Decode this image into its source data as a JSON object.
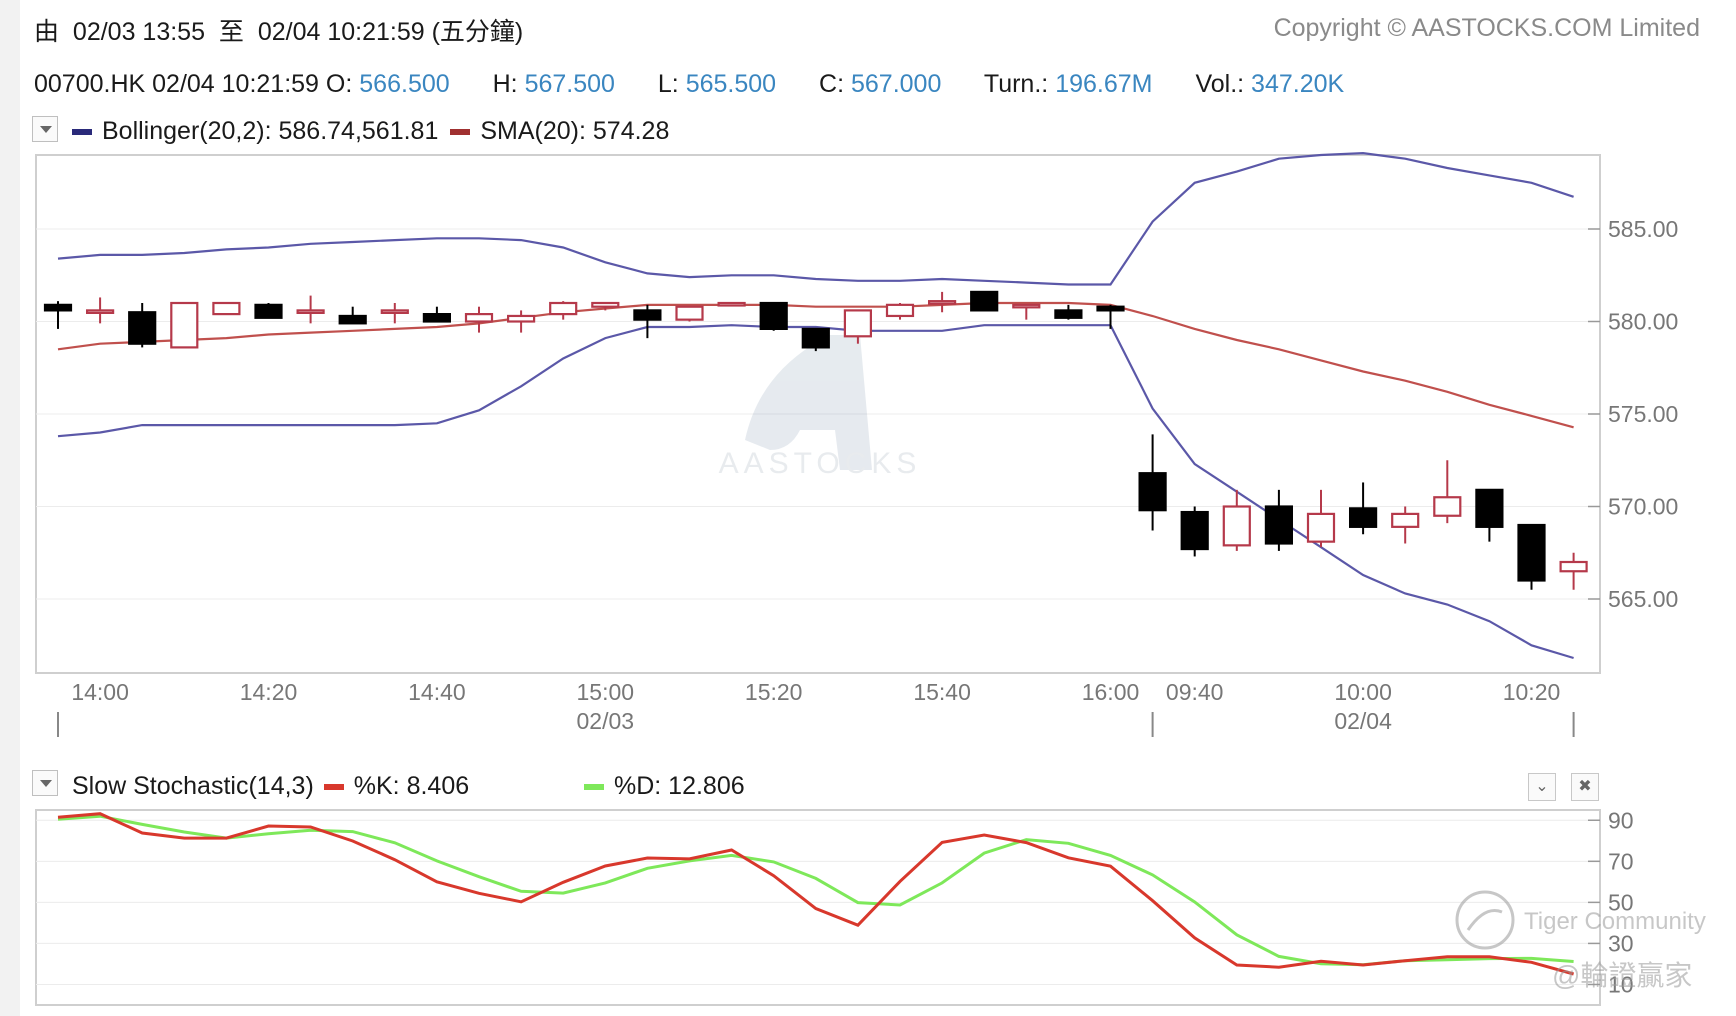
{
  "header": {
    "range_prefix": "由",
    "range_from": "02/03 13:55",
    "range_sep": "至",
    "range_to": "02/04 10:21:59 (五分鐘)",
    "copyright": "Copyright © AASTOCKS.COM Limited"
  },
  "quote": {
    "symbol_time": "00700.HK 02/04 10:21:59",
    "open_label": "O:",
    "open": "566.500",
    "high_label": "H:",
    "high": "567.500",
    "low_label": "L:",
    "low": "565.500",
    "close_label": "C:",
    "close": "567.000",
    "turn_label": "Turn.:",
    "turn": "196.67M",
    "vol_label": "Vol.:",
    "vol": "347.20K"
  },
  "main_legend": {
    "boll_label": "Bollinger(20,2): 586.74,561.81",
    "sma_label": "SMA(20): 574.28"
  },
  "stoch_legend": {
    "title": "Slow Stochastic(14,3)",
    "k_label": "%K: 8.406",
    "d_label": "%D: 12.806"
  },
  "watermarks": {
    "aastocks": "AASTOCKS",
    "tiger": "Tiger Community",
    "handle": "@輪證贏家"
  },
  "colors": {
    "boll": "#5b58a8",
    "sma": "#c0504d",
    "up": "#b5394a",
    "down": "#000000",
    "k": "#d8382c",
    "d": "#7ee85a",
    "value_blue": "#3a86c0"
  },
  "chart_data": [
    {
      "type": "candlestick",
      "title": "00700.HK",
      "x_time_labels": [
        "14:00",
        "14:20",
        "14:40",
        "15:00",
        "15:20",
        "15:40",
        "16:00",
        "09:40",
        "10:00",
        "10:20"
      ],
      "x_date_labels": [
        "02/03",
        "02/04"
      ],
      "y_ticks": [
        "585.00",
        "580.00",
        "575.00",
        "570.00",
        "565.00"
      ],
      "ylim": [
        561,
        589
      ],
      "grid": true,
      "candles": [
        {
          "o": 580.9,
          "h": 581.1,
          "l": 579.6,
          "c": 580.6
        },
        {
          "o": 580.6,
          "h": 581.3,
          "l": 579.9,
          "c": 580.6
        },
        {
          "o": 580.5,
          "h": 581.0,
          "l": 578.6,
          "c": 578.8
        },
        {
          "o": 578.6,
          "h": 581.0,
          "l": 578.6,
          "c": 581.0
        },
        {
          "o": 580.4,
          "h": 581.0,
          "l": 580.4,
          "c": 581.0
        },
        {
          "o": 580.9,
          "h": 581.0,
          "l": 580.2,
          "c": 580.2
        },
        {
          "o": 580.6,
          "h": 581.4,
          "l": 579.9,
          "c": 580.6
        },
        {
          "o": 580.3,
          "h": 580.8,
          "l": 579.9,
          "c": 579.9
        },
        {
          "o": 580.6,
          "h": 581.0,
          "l": 579.9,
          "c": 580.6
        },
        {
          "o": 580.4,
          "h": 580.8,
          "l": 580.0,
          "c": 580.0
        },
        {
          "o": 580.0,
          "h": 580.8,
          "l": 579.4,
          "c": 580.4
        },
        {
          "o": 580.0,
          "h": 580.6,
          "l": 579.4,
          "c": 580.3
        },
        {
          "o": 580.4,
          "h": 581.1,
          "l": 580.1,
          "c": 581.0
        },
        {
          "o": 580.8,
          "h": 581.0,
          "l": 580.6,
          "c": 581.0
        },
        {
          "o": 580.6,
          "h": 580.9,
          "l": 579.1,
          "c": 580.1
        },
        {
          "o": 580.1,
          "h": 580.8,
          "l": 580.0,
          "c": 580.8
        },
        {
          "o": 580.9,
          "h": 581.0,
          "l": 580.9,
          "c": 581.0
        },
        {
          "o": 581.0,
          "h": 581.0,
          "l": 579.5,
          "c": 579.6
        },
        {
          "o": 579.6,
          "h": 579.6,
          "l": 578.4,
          "c": 578.6
        },
        {
          "o": 579.2,
          "h": 580.6,
          "l": 578.8,
          "c": 580.6
        },
        {
          "o": 580.3,
          "h": 581.0,
          "l": 580.1,
          "c": 580.9
        },
        {
          "o": 581.1,
          "h": 581.6,
          "l": 580.5,
          "c": 581.1
        },
        {
          "o": 581.6,
          "h": 581.6,
          "l": 580.6,
          "c": 580.6
        },
        {
          "o": 580.9,
          "h": 580.9,
          "l": 580.1,
          "c": 580.9
        },
        {
          "o": 580.6,
          "h": 580.9,
          "l": 580.1,
          "c": 580.2
        },
        {
          "o": 580.8,
          "h": 580.9,
          "l": 579.6,
          "c": 580.6
        },
        {
          "o": 571.8,
          "h": 573.9,
          "l": 568.7,
          "c": 569.8
        },
        {
          "o": 569.7,
          "h": 570.0,
          "l": 567.3,
          "c": 567.7
        },
        {
          "o": 567.9,
          "h": 570.9,
          "l": 567.6,
          "c": 570.0
        },
        {
          "o": 570.0,
          "h": 570.9,
          "l": 567.6,
          "c": 568.0
        },
        {
          "o": 568.1,
          "h": 570.9,
          "l": 567.8,
          "c": 569.6
        },
        {
          "o": 569.9,
          "h": 571.3,
          "l": 568.5,
          "c": 568.9
        },
        {
          "o": 568.9,
          "h": 570.0,
          "l": 568.0,
          "c": 569.6
        },
        {
          "o": 569.5,
          "h": 572.5,
          "l": 569.1,
          "c": 570.5
        },
        {
          "o": 570.9,
          "h": 570.9,
          "l": 568.1,
          "c": 568.9
        },
        {
          "o": 569.0,
          "h": 569.0,
          "l": 565.5,
          "c": 566.0
        },
        {
          "o": 566.5,
          "h": 567.5,
          "l": 565.5,
          "c": 567.0
        }
      ],
      "series": [
        {
          "name": "Bollinger(20,2)",
          "type": "line",
          "values": [
            583.4,
            583.6,
            583.6,
            583.7,
            583.9,
            584.0,
            584.2,
            584.3,
            584.4,
            584.5,
            584.5,
            584.4,
            584.0,
            583.2,
            582.6,
            582.4,
            582.5,
            582.5,
            582.3,
            582.2,
            582.2,
            582.3,
            582.2,
            582.1,
            582.0,
            582.0,
            585.4,
            587.5,
            588.1,
            588.8,
            589.0,
            589.1,
            588.8,
            588.3,
            587.9,
            587.5,
            586.74
          ]
        },
        {
          "name": "Bollinger(20,2)",
          "type": "line",
          "values": [
            573.8,
            574.0,
            574.4,
            574.4,
            574.4,
            574.4,
            574.4,
            574.4,
            574.4,
            574.5,
            575.2,
            576.5,
            578.0,
            579.1,
            579.7,
            579.7,
            579.8,
            579.7,
            579.7,
            579.5,
            579.5,
            579.5,
            579.8,
            579.8,
            579.8,
            579.8,
            575.3,
            572.3,
            570.8,
            569.3,
            567.8,
            566.3,
            565.3,
            564.7,
            563.8,
            562.5,
            561.81
          ]
        },
        {
          "name": "SMA(20)",
          "type": "line",
          "values": [
            578.5,
            578.8,
            578.9,
            579.0,
            579.1,
            579.3,
            579.4,
            579.5,
            579.6,
            579.7,
            579.9,
            580.2,
            580.5,
            580.7,
            580.9,
            580.9,
            580.9,
            580.9,
            580.8,
            580.8,
            580.8,
            580.9,
            581.0,
            581.0,
            581.0,
            580.9,
            580.3,
            579.6,
            579.0,
            578.5,
            577.9,
            577.3,
            576.8,
            576.2,
            575.5,
            574.9,
            574.28
          ]
        }
      ]
    },
    {
      "type": "line",
      "title": "Slow Stochastic(14,3)",
      "y_ticks": [
        "90",
        "70",
        "50",
        "30",
        "10"
      ],
      "ylim": [
        0,
        95
      ],
      "grid": true,
      "series": [
        {
          "name": "%K",
          "values": [
            91.5,
            93.2,
            83.8,
            81.3,
            81.3,
            87.2,
            86.7,
            79.9,
            70.8,
            60.0,
            54.4,
            50.3,
            59.8,
            67.7,
            71.6,
            71.2,
            75.5,
            63.0,
            47.0,
            38.9,
            60.2,
            79.2,
            82.8,
            79.1,
            71.7,
            67.6,
            50.8,
            32.7,
            19.5,
            18.4,
            21.3,
            19.5,
            21.6,
            23.5,
            23.5,
            20.8,
            15.1
          ]
        },
        {
          "name": "%D",
          "values": [
            90.5,
            92.0,
            88.0,
            84.3,
            81.3,
            83.4,
            85.1,
            84.5,
            79.0,
            70.2,
            62.5,
            55.4,
            54.5,
            59.5,
            66.6,
            70.2,
            72.9,
            69.7,
            61.7,
            49.9,
            48.7,
            59.5,
            74.0,
            80.6,
            78.8,
            72.9,
            63.4,
            50.2,
            34.2,
            23.7,
            20.1,
            19.6,
            21.6,
            22.0,
            22.6,
            22.7,
            21.2
          ]
        }
      ]
    }
  ]
}
